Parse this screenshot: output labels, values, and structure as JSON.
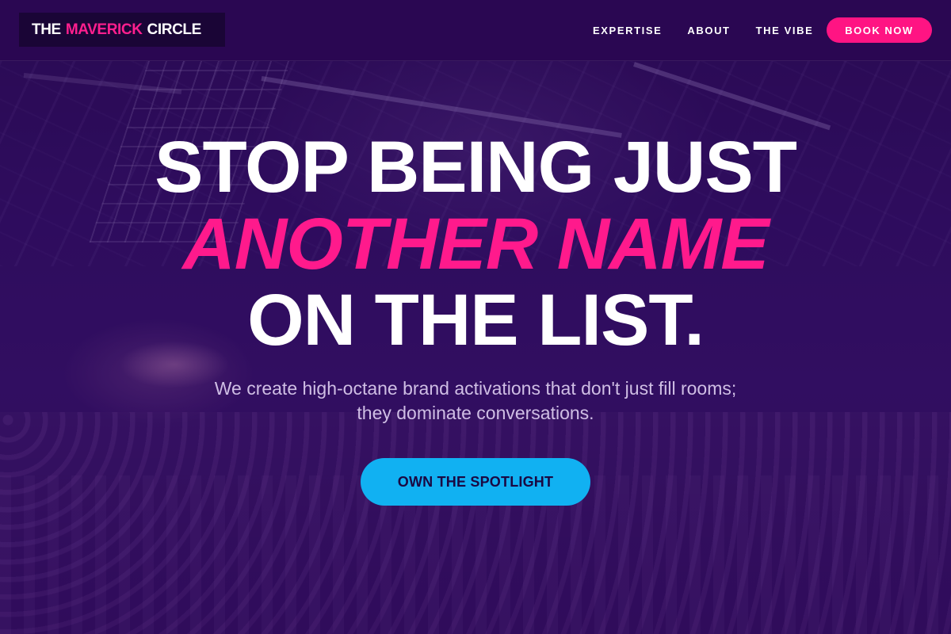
{
  "brand": {
    "logo_prefix": "THE",
    "logo_accent": "MAVERICK",
    "logo_suffix": "CIRCLE"
  },
  "nav": {
    "items": [
      {
        "label": "EXPERTISE"
      },
      {
        "label": "ABOUT"
      },
      {
        "label": "THE VIBE"
      }
    ],
    "cta_label": "BOOK NOW"
  },
  "hero": {
    "headline_line1": "STOP BEING JUST",
    "headline_line2": "ANOTHER NAME",
    "headline_line3": "ON THE LIST.",
    "subheadline": "We create high-octane brand activations that don't just fill rooms; they dominate conversations.",
    "cta_label": "OWN THE SPOTLIGHT"
  },
  "colors": {
    "background": "#2a0a52",
    "accent_pink": "#ff1a8c",
    "accent_blue": "#11b1f2",
    "text_white": "#ffffff"
  }
}
